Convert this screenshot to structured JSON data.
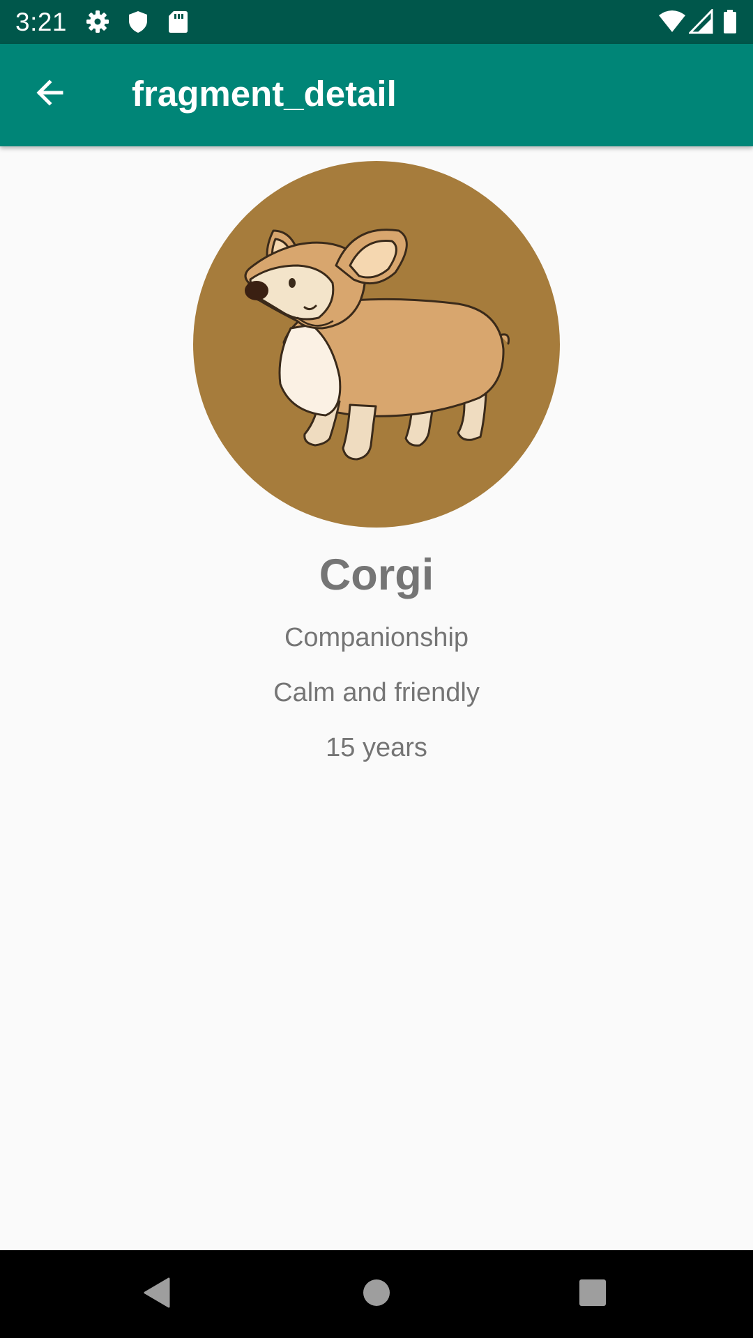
{
  "status_bar": {
    "time": "3:21",
    "icons": [
      "gear-icon",
      "shield-icon",
      "sd-card-icon",
      "wifi-icon",
      "cell-signal-icon",
      "battery-icon"
    ]
  },
  "app_bar": {
    "title": "fragment_detail",
    "back_icon": "arrow-back-icon",
    "background_color": "#008577",
    "status_color": "#00574b"
  },
  "detail": {
    "image": "corgi-illustration",
    "image_background": "#a67c3c",
    "name": "Corgi",
    "bred_for": "Companionship",
    "temperament": "Calm and friendly",
    "life_span": "15 years"
  },
  "nav_bar": {
    "buttons": [
      "back-triangle-icon",
      "home-circle-icon",
      "recents-square-icon"
    ]
  }
}
